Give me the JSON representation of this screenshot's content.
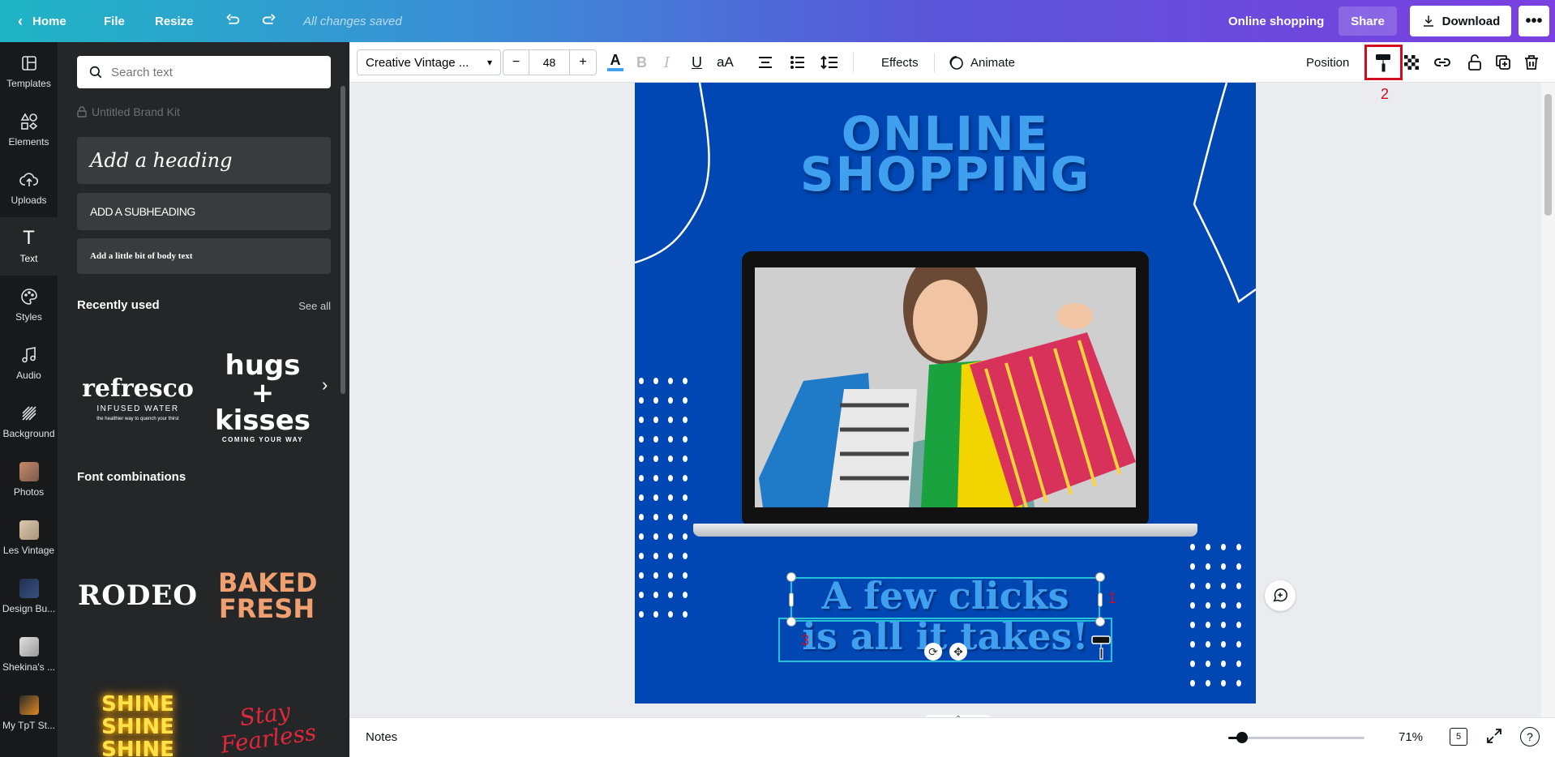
{
  "topbar": {
    "home": "Home",
    "file": "File",
    "resize": "Resize",
    "saved_status": "All changes saved",
    "design_title": "Online shopping",
    "share": "Share",
    "download": "Download",
    "more": "•••"
  },
  "rail": [
    {
      "label": "Templates",
      "icon": "templates-icon"
    },
    {
      "label": "Elements",
      "icon": "elements-icon"
    },
    {
      "label": "Uploads",
      "icon": "uploads-icon"
    },
    {
      "label": "Text",
      "icon": "text-icon"
    },
    {
      "label": "Styles",
      "icon": "styles-icon"
    },
    {
      "label": "Audio",
      "icon": "audio-icon"
    },
    {
      "label": "Background",
      "icon": "background-icon"
    },
    {
      "label": "Photos",
      "icon": "photos-icon"
    },
    {
      "label": "Les Vintage",
      "icon": "folder-thumb"
    },
    {
      "label": "Design Bu...",
      "icon": "folder-thumb"
    },
    {
      "label": "Shekina's ...",
      "icon": "folder-thumb"
    },
    {
      "label": "My TpT St...",
      "icon": "folder-thumb"
    }
  ],
  "panel": {
    "search_placeholder": "Search text",
    "brand_kit": "Untitled Brand Kit",
    "add_heading": "Add a heading",
    "add_subheading": "ADD A SUBHEADING",
    "add_body": "Add a little bit of body text",
    "recently_used": "Recently used",
    "see_all": "See all",
    "recent": [
      {
        "big": "refresco",
        "sub": "INFUSED WATER",
        "small": "the healthier way to quench your thirst"
      },
      {
        "big": "hugs + kisses",
        "sub": "COMING YOUR WAY"
      }
    ],
    "font_combinations": "Font combinations",
    "combos": [
      "RODEO",
      "BAKED FRESH",
      "SHINE SHINE SHINE",
      "Stay Fearless"
    ]
  },
  "toolbar": {
    "font": "Creative Vintage ...",
    "size": "48",
    "minus": "−",
    "plus": "+",
    "bold": "B",
    "italic": "I",
    "underline": "U",
    "case": "aA",
    "effects": "Effects",
    "animate": "Animate",
    "position": "Position",
    "annotation_2": "2"
  },
  "design": {
    "headline_1": "ONLINE",
    "headline_2": "SHOPPING",
    "tagline_1": "A few clicks",
    "tagline_2": "is all it takes!",
    "annotation_1": "1",
    "annotation_3": "3"
  },
  "footer": {
    "notes": "Notes",
    "zoom": "71%",
    "page_count": "5",
    "help": "?",
    "zoom_level": 0.1
  },
  "colors": {
    "design_bg": "#0047b3",
    "headline": "#3fa0f0",
    "selection": "#22c3d8",
    "annotation_red": "#d00d1d"
  }
}
